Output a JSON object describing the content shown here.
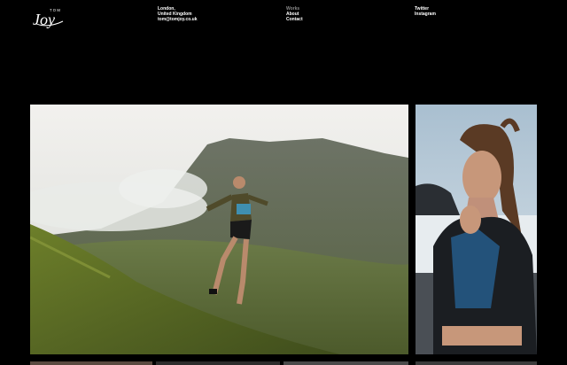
{
  "brand": {
    "logo_small": "TOM",
    "logo_script": "Joy",
    "logo_icon": "signature-logo"
  },
  "header": {
    "address": {
      "city": "London,",
      "country": "United Kingdom",
      "email": "tom@tomjoy.co.uk"
    },
    "nav": [
      {
        "label": "Works",
        "active": true
      },
      {
        "label": "About",
        "active": false
      },
      {
        "label": "Contact",
        "active": false
      }
    ],
    "social": [
      {
        "label": "Twitter"
      },
      {
        "label": "Instagram"
      }
    ]
  },
  "gallery": {
    "photos": [
      {
        "name": "trail-runner-mountain-photo",
        "icon": "landscape-photo"
      },
      {
        "name": "athlete-portrait-photo",
        "icon": "portrait-photo"
      }
    ]
  },
  "colors": {
    "background": "#000000",
    "text": "#ffffff",
    "muted": "#8a8a8a"
  }
}
